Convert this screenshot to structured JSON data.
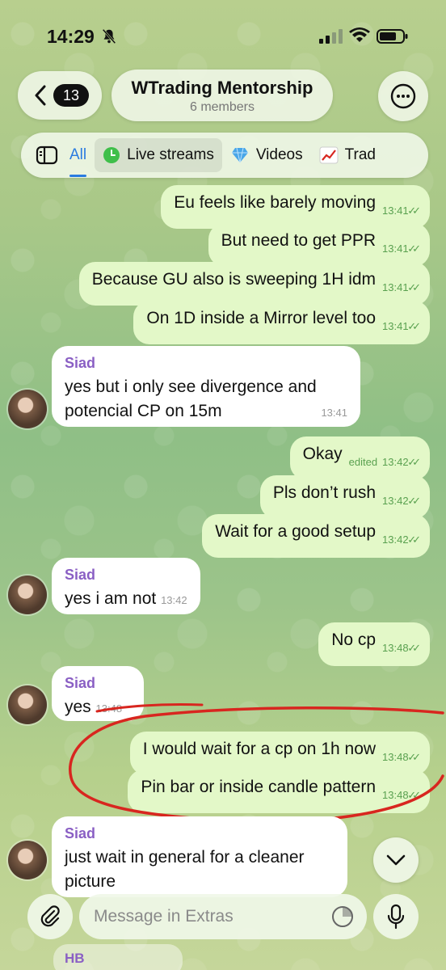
{
  "status_bar": {
    "time": "14:29"
  },
  "header": {
    "back_badge": "13",
    "title": "WTrading Mentorship",
    "subtitle": "6 members"
  },
  "tabs": [
    {
      "label": "All"
    },
    {
      "label": "Live streams"
    },
    {
      "label": "Videos"
    },
    {
      "label": "Trad"
    }
  ],
  "messages": [
    {
      "dir": "out",
      "text": "Eu feels like barely moving",
      "time": "13:41"
    },
    {
      "dir": "out",
      "text": "But need to get PPR",
      "time": "13:41"
    },
    {
      "dir": "out",
      "text": "Because GU also is sweeping 1H idm",
      "time": "13:41"
    },
    {
      "dir": "out",
      "text": "On 1D inside a Mirror level too",
      "time": "13:41"
    },
    {
      "dir": "in",
      "sender": "Siad",
      "line1": "yes but i only see divergence and",
      "line2": "potencial CP on 15m",
      "time": "13:41"
    },
    {
      "dir": "out",
      "text": "Okay",
      "edited": "edited",
      "time": "13:42"
    },
    {
      "dir": "out",
      "text": "Pls don’t rush",
      "time": "13:42"
    },
    {
      "dir": "out",
      "text": "Wait for a good setup",
      "time": "13:42"
    },
    {
      "dir": "in",
      "sender": "Siad",
      "text": "yes i am not",
      "time": "13:42"
    },
    {
      "dir": "out",
      "text": "No cp",
      "time": "13:48"
    },
    {
      "dir": "in",
      "sender": "Siad",
      "text": "yes",
      "time": "13:48"
    },
    {
      "dir": "out",
      "text": "I would wait for a cp on 1h now",
      "time": "13:48"
    },
    {
      "dir": "out",
      "text": "Pin bar or inside candle pattern",
      "time": "13:48"
    },
    {
      "dir": "in",
      "sender": "Siad",
      "line1": "just wait in general for a cleaner",
      "line2": "picture"
    }
  ],
  "composer": {
    "placeholder": "Message in Extras"
  },
  "bottom_peek": {
    "sender": "HB"
  },
  "colors": {
    "outgoing_bubble": "#e3f8c8",
    "incoming_bubble": "#ffffff",
    "accent": "#2a7be0",
    "sender_name": "#8a5fc4",
    "annotation": "#d8261f"
  }
}
